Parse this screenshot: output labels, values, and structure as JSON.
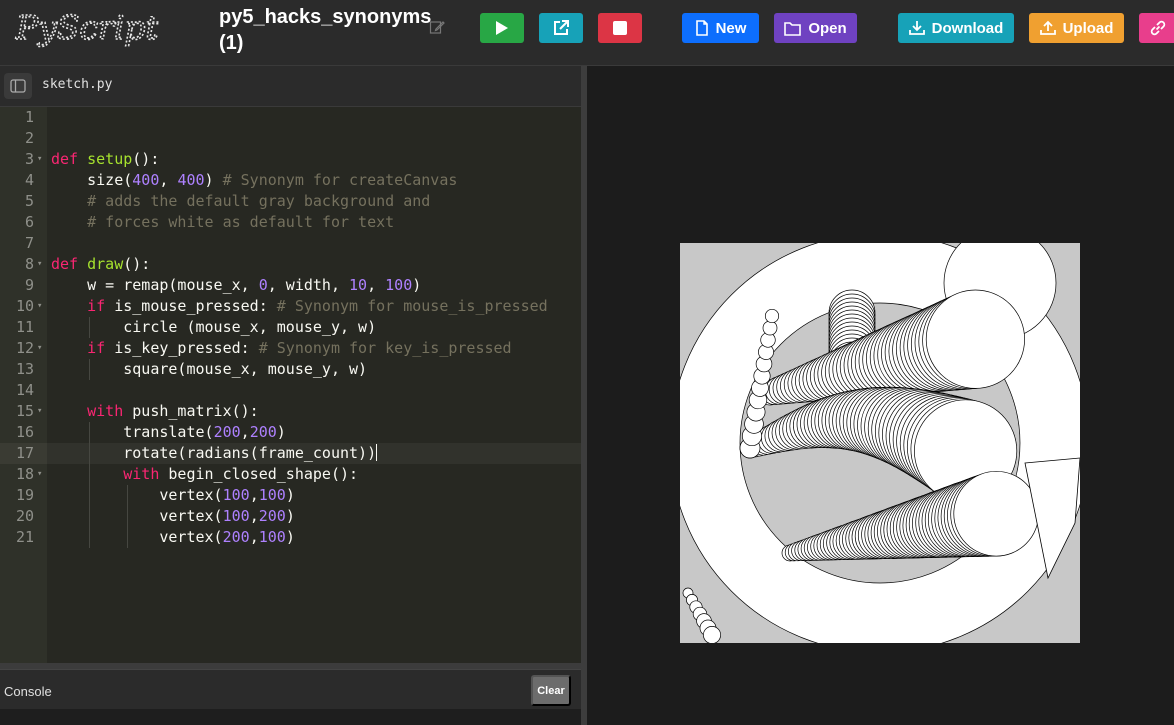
{
  "app": {
    "logo_text": "PyScript",
    "project_title": "py5_hacks_synonyms (1)"
  },
  "toolbar": {
    "run": {
      "icon": "play-icon"
    },
    "share": {
      "icon": "external-link-icon"
    },
    "stop": {
      "icon": "stop-icon"
    },
    "new_label": "New",
    "open_label": "Open",
    "download_label": "Download",
    "upload_label": "Upload",
    "link": {
      "icon": "link-icon"
    }
  },
  "colors": {
    "run": "#28a745",
    "share": "#17a2b8",
    "stop": "#dc3545",
    "new": "#0d6efd",
    "open": "#6f42c1",
    "download": "#17a2b8",
    "upload": "#f0a030",
    "link": "#e83e8c"
  },
  "editor": {
    "file_name": "sketch.py",
    "active_line": 17,
    "lines": [
      {
        "n": "1",
        "text": ""
      },
      {
        "n": "2",
        "text": ""
      },
      {
        "n": "3",
        "text": "def setup():"
      },
      {
        "n": "4",
        "text": "    size(400, 400) # Synonym for createCanvas"
      },
      {
        "n": "5",
        "text": "    # adds the default gray background and"
      },
      {
        "n": "6",
        "text": "    # forces white as default for text"
      },
      {
        "n": "7",
        "text": ""
      },
      {
        "n": "8",
        "text": "def draw():"
      },
      {
        "n": "9",
        "text": "    w = remap(mouse_x, 0, width, 10, 100)"
      },
      {
        "n": "10",
        "text": "    if is_mouse_pressed: # Synonym for mouse_is_pressed"
      },
      {
        "n": "11",
        "text": "        circle (mouse_x, mouse_y, w)"
      },
      {
        "n": "12",
        "text": "    if is_key_pressed: # Synonym for key_is_pressed"
      },
      {
        "n": "13",
        "text": "        square(mouse_x, mouse_y, w)"
      },
      {
        "n": "14",
        "text": ""
      },
      {
        "n": "15",
        "text": "    with push_matrix():"
      },
      {
        "n": "16",
        "text": "        translate(200,200)"
      },
      {
        "n": "17",
        "text": "        rotate(radians(frame_count))"
      },
      {
        "n": "18",
        "text": "        with begin_closed_shape():"
      },
      {
        "n": "19",
        "text": "            vertex(100,100)"
      },
      {
        "n": "20",
        "text": "            vertex(100,200)"
      },
      {
        "n": "21",
        "text": "            vertex(200,100)"
      }
    ]
  },
  "console": {
    "label": "Console",
    "clear_label": "Clear"
  }
}
